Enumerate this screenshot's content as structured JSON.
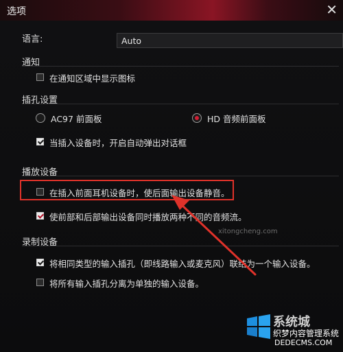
{
  "window": {
    "title": "选项",
    "close_glyph": "✕"
  },
  "language": {
    "label": "语言:",
    "value": "Auto"
  },
  "notify": {
    "section": "通知",
    "show_icon": {
      "label": "在通知区域中显示图标",
      "checked": false
    }
  },
  "jack_settings": {
    "section": "插孔设置",
    "ac97": {
      "label": "AC97 前面板",
      "selected": false
    },
    "hd": {
      "label": "HD 音频前面板",
      "selected": true
    },
    "auto_popup": {
      "label": "当插入设备时，开启自动弹出对话框",
      "checked": true
    }
  },
  "playback": {
    "section": "播放设备",
    "mute_rear": {
      "label": "在插入前面耳机设备时，使后面输出设备静音。",
      "checked": false
    },
    "multi_stream": {
      "label": "使前部和后部输出设备同时播放两种不同的音频流。",
      "checked": true
    }
  },
  "recording": {
    "section": "录制设备",
    "merge_inputs": {
      "label": "将相同类型的输入插孔（即线路输入或麦克风）联结为一个输入设备。",
      "checked": true
    },
    "separate_inputs": {
      "label": "将所有输入插孔分离为单独的输入设备。",
      "checked": false
    }
  },
  "watermark": {
    "faint_text": "xitongcheng.com",
    "brand": "系统城",
    "cn_text": "织梦内容管理系统",
    "url": "DEDECMS.COM"
  },
  "colors": {
    "accent": "#d21e34",
    "annotation": "#e0322a"
  }
}
